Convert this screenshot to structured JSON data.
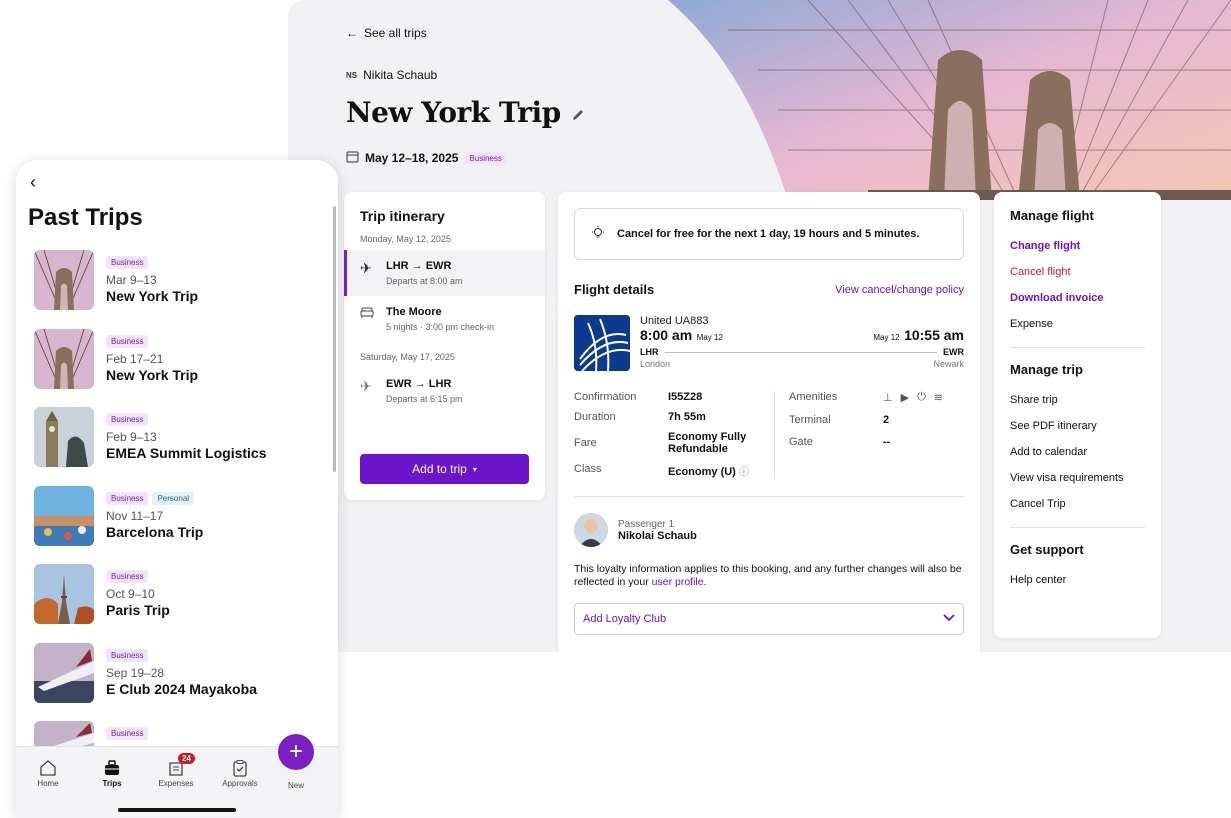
{
  "colors": {
    "accent": "#6c14c9",
    "danger": "#d11b24",
    "surface": "#f2f2f4"
  },
  "desktop": {
    "back_label": "See all trips",
    "traveler_initials": "NS",
    "traveler_name": "Nikita Schaub",
    "trip_title": "New York Trip",
    "trip_dates": "May 12–18, 2025",
    "trip_tag": "Business"
  },
  "itinerary": {
    "title": "Trip itinerary",
    "day1": "Monday, May 12, 2025",
    "items": [
      {
        "title": "LHR → EWR",
        "subtitle": "Departs at 8:00 am",
        "icon": "plane-icon"
      },
      {
        "title": "The Moore",
        "subtitle": "5 nights · 3:00 pm check-in",
        "icon": "bed-icon"
      },
      {
        "title": "EWR → LHR",
        "subtitle": "Departs at 6:15 pm",
        "icon": "plane-icon"
      }
    ],
    "day2": "Saturday, May 17, 2025",
    "add_button": "Add to trip"
  },
  "flight": {
    "cancel_banner": "Cancel for free for the next 1 day, 19 hours and 5 minutes.",
    "section_title": "Flight details",
    "policy_link": "View cancel/change policy",
    "carrier": "United UA883",
    "depart_time": "8:00 am",
    "depart_date": "May 12",
    "arrive_date": "May 12",
    "arrive_time": "10:55 am",
    "from_code": "LHR",
    "to_code": "EWR",
    "from_city": "London",
    "to_city": "Newark",
    "labels": {
      "confirmation": "Confirmation",
      "duration": "Duration",
      "fare": "Fare",
      "class": "Class",
      "amenities": "Amenities",
      "terminal": "Terminal",
      "gate": "Gate"
    },
    "values": {
      "confirmation": "I55Z28",
      "duration": "7h 55m",
      "fare": "Economy Fully Refundable",
      "class": "Economy (U)",
      "terminal": "2",
      "gate": "--"
    },
    "passenger_label": "Passenger 1",
    "passenger_name": "Nikolai Schaub",
    "loyalty_note": "This loyalty information applies to this booking, and any further changes will also be reflected in your",
    "loyalty_link": "user profile",
    "loyalty_select": "Add Loyalty Club"
  },
  "manage": {
    "flight_title": "Manage flight",
    "change_flight": "Change flight",
    "cancel_flight": "Cancel flight",
    "download_invoice": "Download invoice",
    "expense": "Expense",
    "trip_title": "Manage trip",
    "share_trip": "Share trip",
    "see_pdf": "See PDF itinerary",
    "add_calendar": "Add to calendar",
    "visa": "View visa requirements",
    "cancel_trip": "Cancel Trip",
    "support_title": "Get support",
    "help_center": "Help center"
  },
  "phone": {
    "title": "Past Trips",
    "trips": [
      {
        "tags": [
          "Business"
        ],
        "dates": "Mar 9–13",
        "name": "New York Trip",
        "thumb": "bridge"
      },
      {
        "tags": [
          "Business"
        ],
        "dates": "Feb 17–21",
        "name": "New York Trip",
        "thumb": "bridge"
      },
      {
        "tags": [
          "Business"
        ],
        "dates": "Feb 9–13",
        "name": "EMEA Summit Logistics",
        "thumb": "london"
      },
      {
        "tags": [
          "Business",
          "Personal"
        ],
        "dates": "Nov 11–17",
        "name": "Barcelona Trip",
        "thumb": "barcelona"
      },
      {
        "tags": [
          "Business"
        ],
        "dates": "Oct 9–10",
        "name": "Paris Trip",
        "thumb": "paris"
      },
      {
        "tags": [
          "Business"
        ],
        "dates": "Sep 19–28",
        "name": "E Club 2024 Mayakoba",
        "thumb": "plane"
      },
      {
        "tags": [
          "Business"
        ],
        "dates": "",
        "name": "",
        "thumb": "plane"
      }
    ],
    "tabs": {
      "home": "Home",
      "trips": "Trips",
      "expenses": "Expenses",
      "approvals": "Approvals",
      "new": "New"
    },
    "expenses_badge": "24"
  }
}
